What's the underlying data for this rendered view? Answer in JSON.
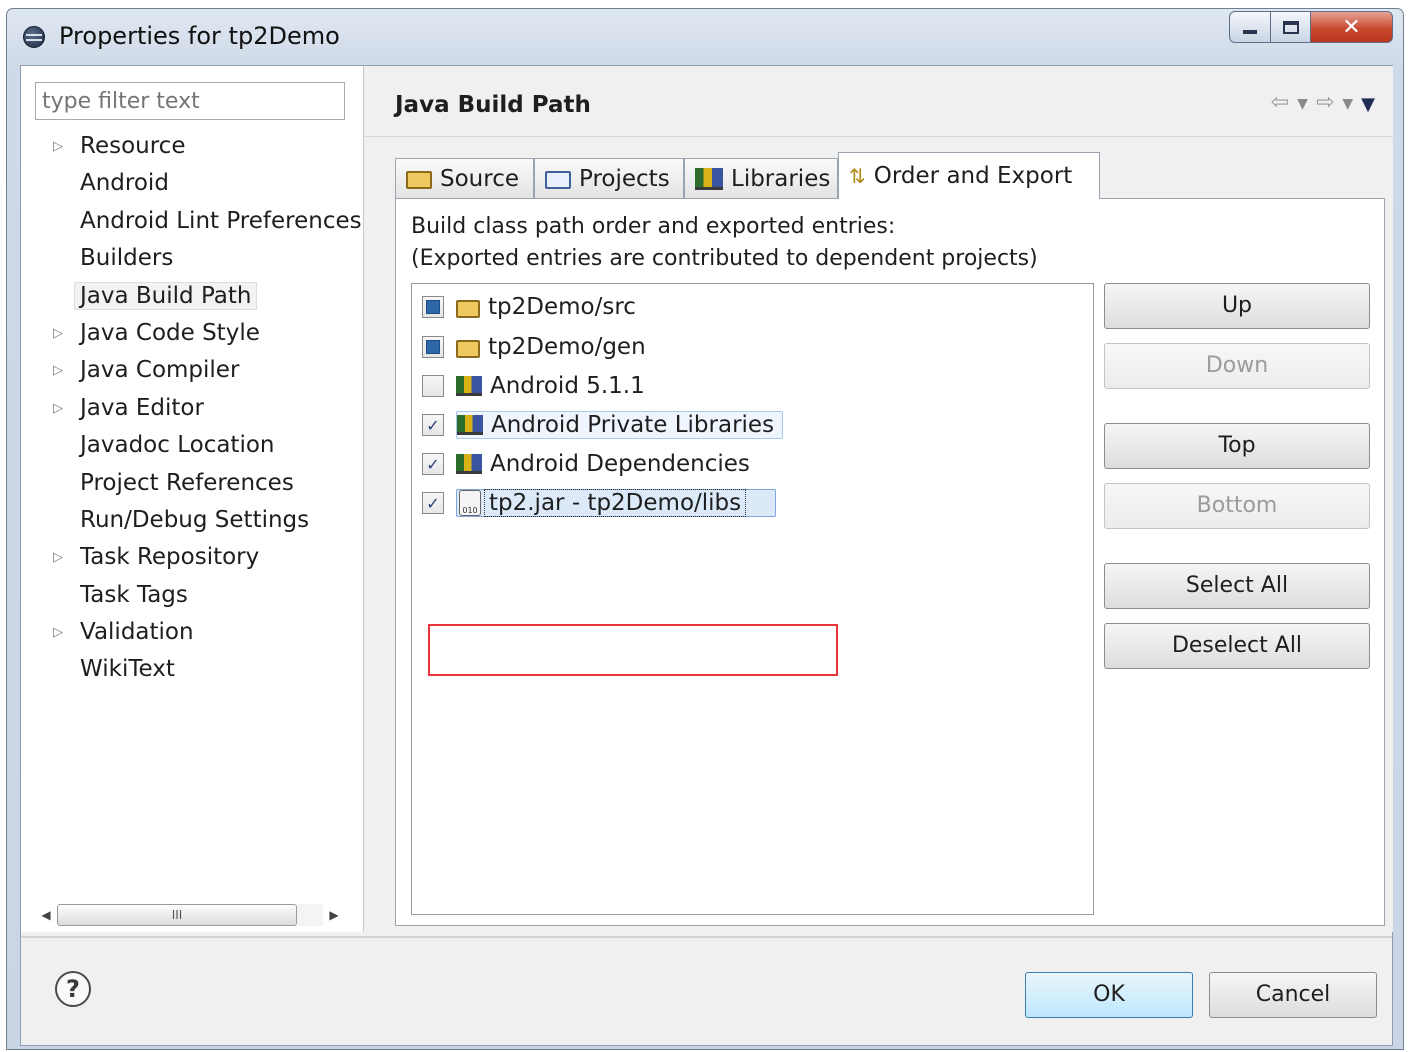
{
  "window": {
    "title": "Properties for tp2Demo"
  },
  "filter": {
    "placeholder": "type filter text"
  },
  "tree": {
    "items": [
      {
        "label": "Resource",
        "expandable": true
      },
      {
        "label": "Android",
        "expandable": false
      },
      {
        "label": "Android Lint Preferences",
        "expandable": false
      },
      {
        "label": "Builders",
        "expandable": false
      },
      {
        "label": "Java Build Path",
        "expandable": false,
        "selected": true
      },
      {
        "label": "Java Code Style",
        "expandable": true
      },
      {
        "label": "Java Compiler",
        "expandable": true
      },
      {
        "label": "Java Editor",
        "expandable": true
      },
      {
        "label": "Javadoc Location",
        "expandable": false
      },
      {
        "label": "Project References",
        "expandable": false
      },
      {
        "label": "Run/Debug Settings",
        "expandable": false
      },
      {
        "label": "Task Repository",
        "expandable": true
      },
      {
        "label": "Task Tags",
        "expandable": false
      },
      {
        "label": "Validation",
        "expandable": true
      },
      {
        "label": "WikiText",
        "expandable": false
      }
    ],
    "scroll_thumb": "III"
  },
  "page": {
    "title": "Java Build Path"
  },
  "tabs": [
    {
      "label": "Source",
      "icon": "source-folder-icon"
    },
    {
      "label": "Projects",
      "icon": "projects-folder-icon"
    },
    {
      "label": "Libraries",
      "icon": "libraries-icon"
    },
    {
      "label": "Order and Export",
      "icon": "order-export-icon",
      "active": true
    }
  ],
  "panel": {
    "desc_line1": "Build class path order and exported entries:",
    "desc_line2": "(Exported entries are contributed to dependent projects)",
    "entries": [
      {
        "label": "tp2Demo/src",
        "state": "partial",
        "icon": "source-folder-icon"
      },
      {
        "label": "tp2Demo/gen",
        "state": "partial",
        "icon": "source-folder-icon"
      },
      {
        "label": "Android 5.1.1",
        "state": "unchecked",
        "icon": "library-icon"
      },
      {
        "label": "Android Private Libraries",
        "state": "checked",
        "icon": "library-icon"
      },
      {
        "label": "Android Dependencies",
        "state": "checked",
        "icon": "library-icon"
      },
      {
        "label": "tp2.jar - tp2Demo/libs",
        "state": "checked",
        "icon": "jar-icon",
        "jar_text": "010"
      }
    ],
    "buttons": {
      "up": "Up",
      "down": "Down",
      "top": "Top",
      "bottom": "Bottom",
      "select_all": "Select All",
      "deselect_all": "Deselect All"
    }
  },
  "footer": {
    "help": "?",
    "ok": "OK",
    "cancel": "Cancel"
  },
  "colors": {
    "highlight_box": "#e8343a",
    "ok_border": "#3c7fb1",
    "close_button": "#c94b31"
  }
}
